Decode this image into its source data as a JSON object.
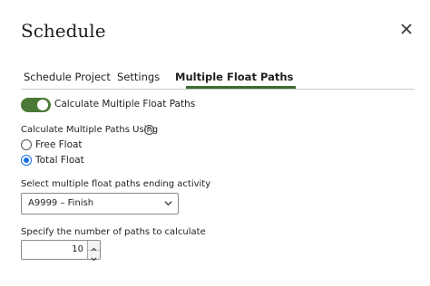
{
  "dialog": {
    "title": "Schedule"
  },
  "tabs": [
    {
      "label": "Schedule Project"
    },
    {
      "label": "Settings"
    },
    {
      "label": "Multiple Float Paths"
    }
  ],
  "calc_toggle": {
    "label": "Calculate Multiple Float Paths",
    "on": true
  },
  "paths_using": {
    "label": "Calculate Multiple Paths Using",
    "options": [
      {
        "label": "Free Float",
        "selected": false
      },
      {
        "label": "Total Float",
        "selected": true
      }
    ]
  },
  "ending_activity": {
    "label": "Select multiple float paths ending activity",
    "value": "A9999 – Finish"
  },
  "paths_count": {
    "label": "Specify the number of paths to calculate",
    "value": "10"
  },
  "colors": {
    "accent": "#4a7a36",
    "radio": "#1a73e8"
  }
}
